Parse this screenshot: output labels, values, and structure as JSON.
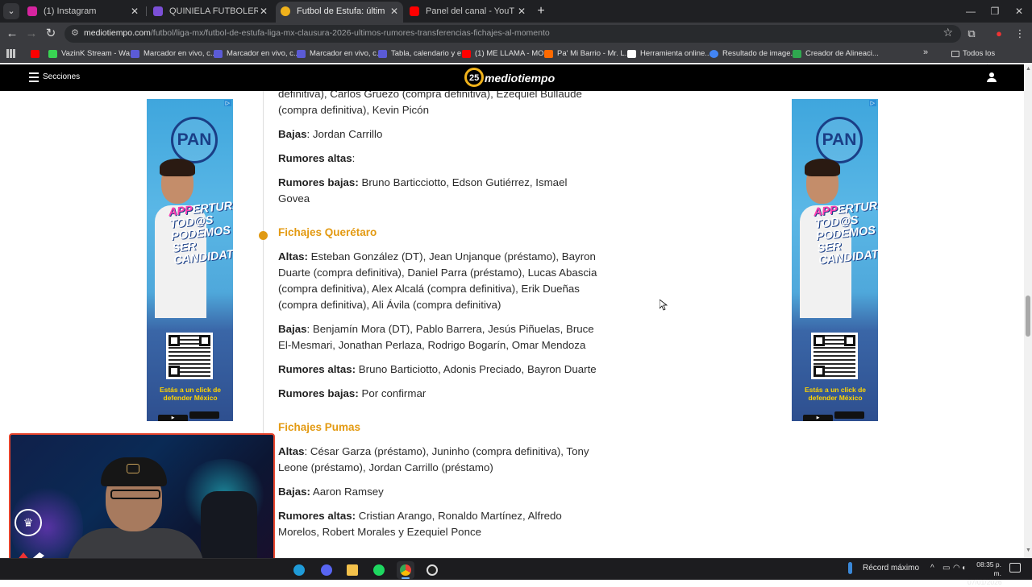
{
  "browser": {
    "tabs": [
      {
        "title": "(1) Instagram",
        "favicon_color": "#d6249f",
        "active": false
      },
      {
        "title": "QUINIELA FUTBOLERA JORNADA",
        "favicon_color": "#7b4fd6",
        "active": false
      },
      {
        "title": "Futbol de Estufa: últimos fichajes",
        "favicon_color": "#f0b21b",
        "active": true
      },
      {
        "title": "Panel del canal - YouTube Studio",
        "favicon_color": "#ff0000",
        "active": false
      }
    ],
    "url_host": "mediotiempo.com",
    "url_path": "/futbol/liga-mx/futbol-de-estufa-liga-mx-clausura-2026-ultimos-rumores-transferencias-fichajes-al-momento",
    "bookmarks": [
      {
        "label": "",
        "color": "#ff0000"
      },
      {
        "label": "VazinK Stream - Wa...",
        "color": "#39d353"
      },
      {
        "label": "Marcador en vivo, c...",
        "color": "#5b5bd6"
      },
      {
        "label": "Marcador en vivo, c...",
        "color": "#5b5bd6"
      },
      {
        "label": "Marcador en vivo, c...",
        "color": "#5b5bd6"
      },
      {
        "label": "Tabla, calendario y e...",
        "color": "#5b5bd6"
      },
      {
        "label": "(1) ME LLAMA - MO...",
        "color": "#ff0000"
      },
      {
        "label": "Pa' Mi Barrio - Mr. L...",
        "color": "#ff6a00"
      },
      {
        "label": "Herramienta online...",
        "color": "#ffffff"
      },
      {
        "label": "Resultado de image...",
        "color": "#4285f4"
      },
      {
        "label": "Creador de Alineaci...",
        "color": "#2fa84f"
      }
    ],
    "all_bookmarks": "Todos los marcadores"
  },
  "site": {
    "sections_label": "Secciones",
    "logo_number": "25",
    "logo_text": "mediotiempo"
  },
  "article": {
    "intro_lines": "definitiva), Carlos Gruezo (compra definitiva), Ezequiel Bullaude (compra definitiva), Kevin Picón",
    "prev_bajas_label": "Bajas",
    "prev_bajas": ": Jordan Carrillo",
    "prev_rumores_altas_label": "Rumores altas",
    "prev_rumores_altas": ":",
    "prev_rumores_bajas_label": "Rumores bajas:",
    "prev_rumores_bajas": " Bruno Barticciotto, Edson Gutiérrez, Ismael Govea",
    "queretaro": {
      "title": "Fichajes Querétaro",
      "altas_label": "Altas:",
      "altas": " Esteban González (DT), Jean Unjanque (préstamo), Bayron Duarte (compra definitiva), Daniel Parra (préstamo), Lucas Abascia (compra definitiva), Alex Alcalá (compra definitiva), Erik Dueñas (compra definitiva), Ali Ávila (compra definitiva)",
      "bajas_label": "Bajas",
      "bajas": ": Benjamín Mora (DT), Pablo Barrera, Jesús Piñuelas, Bruce El-Mesmari, Jonathan Perlaza, Rodrigo Bogarín, Omar Mendoza",
      "rumores_altas_label": "Rumores altas:",
      "rumores_altas": " Bruno Barticiotto, Adonis Preciado, Bayron Duarte",
      "rumores_bajas_label": "Rumores bajas:",
      "rumores_bajas": " Por confirmar"
    },
    "pumas": {
      "title": "Fichajes Pumas",
      "altas_label": "Altas",
      "altas": ": César Garza (préstamo), Juninho (compra definitiva), Tony Leone (préstamo), Jordan Carrillo (préstamo)",
      "bajas_label": "Bajas:",
      "bajas": " Aaron Ramsey",
      "rumores_altas_label": "Rumores altas:",
      "rumores_altas": " Cristian Arango, Ronaldo Martínez, Alfredo Morelos, Robert Morales y Ezequiel Ponce"
    }
  },
  "ads": {
    "brand": "PAN",
    "slogan_1": "APP",
    "slogan_2": "ERTURA",
    "slogan_3": "TOD@S",
    "slogan_4": "PODEMOS",
    "slogan_5": "SER",
    "slogan_6": "CANDIDAT@S",
    "tagline": "Estás a un click de defender México"
  },
  "taskbar": {
    "weather_label": "Récord máximo",
    "time": "08:35 p. m.",
    "date": "07/01/2026"
  },
  "colors": {
    "accent_orange": "#e39a12",
    "webcam_border": "#e8452d"
  }
}
